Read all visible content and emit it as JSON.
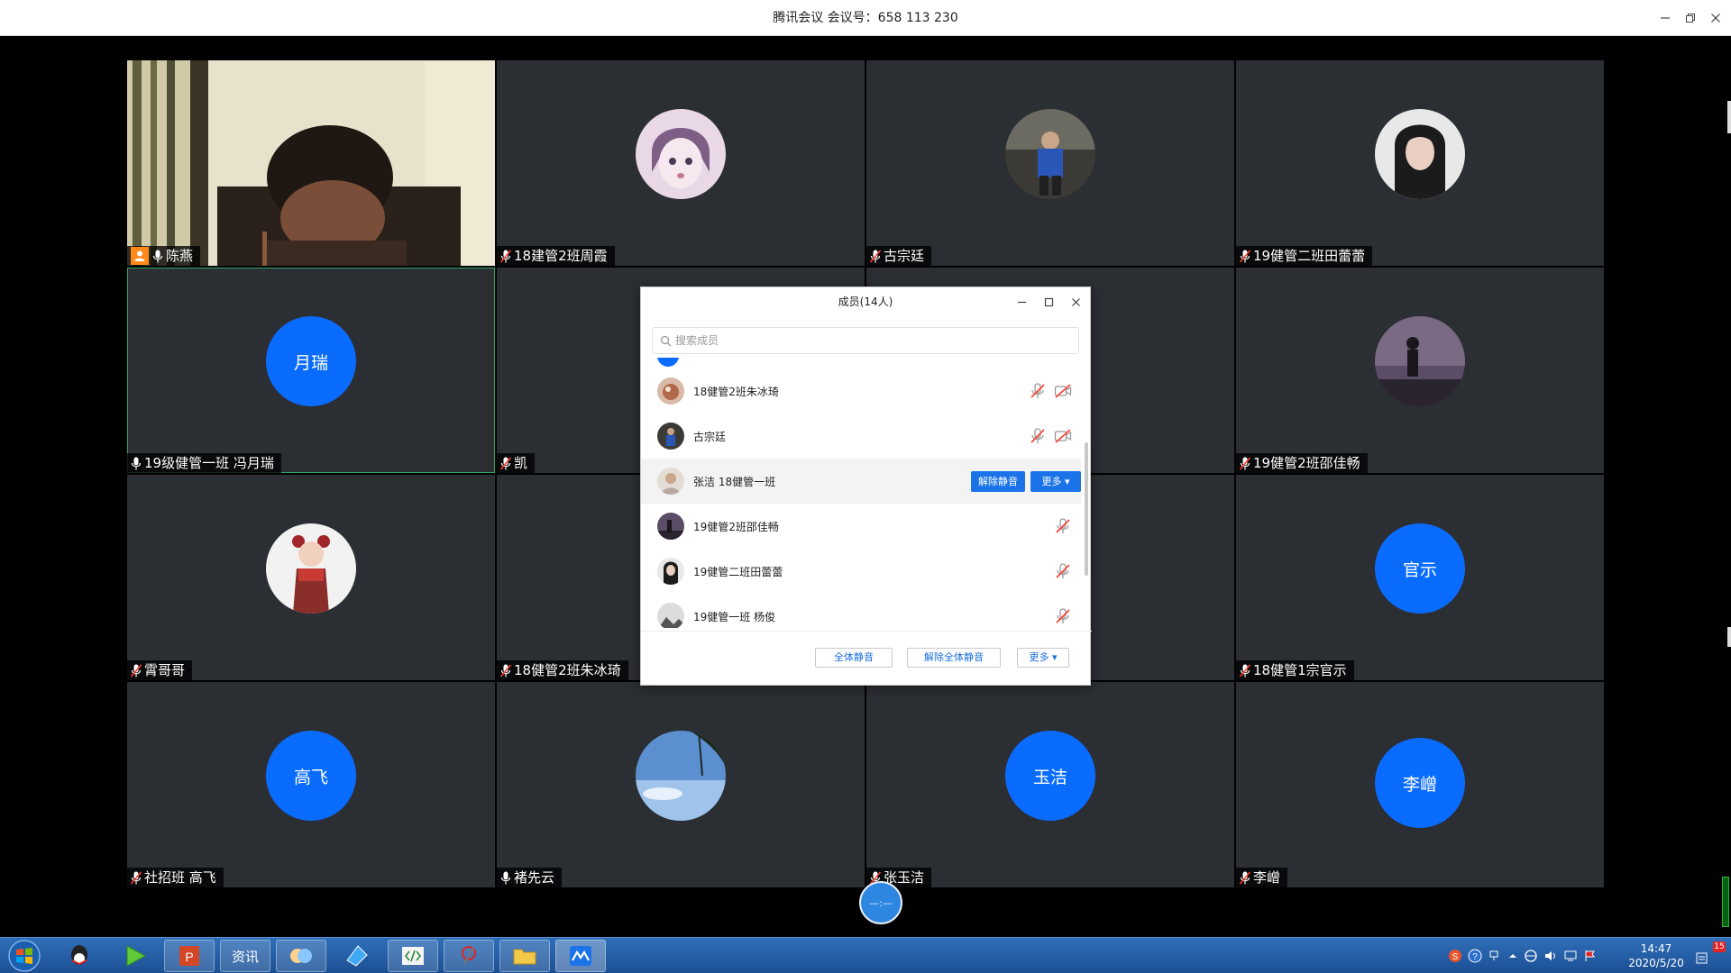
{
  "window": {
    "title": "腾讯会议 会议号：658 113 230"
  },
  "tiles": [
    {
      "name": "陈燕",
      "type": "camera",
      "host": true
    },
    {
      "name": "18建管2班周霞",
      "type": "photo",
      "muted": true
    },
    {
      "name": "古宗廷",
      "type": "photo",
      "muted": true
    },
    {
      "name": "19健管二班田蕾蕾",
      "type": "photo",
      "muted": true
    },
    {
      "name": "19级健管一班  冯月瑞",
      "type": "letter",
      "letter": "月瑞",
      "active": true
    },
    {
      "name": "凯",
      "type": "blank",
      "muted": true
    },
    {
      "name": "",
      "type": "blank"
    },
    {
      "name": "19健管2班邵佳畅",
      "type": "photo",
      "muted": true
    },
    {
      "name": "霄哥哥",
      "type": "photo",
      "muted": true
    },
    {
      "name": "18健管2班朱冰琦",
      "type": "blank",
      "muted": true
    },
    {
      "name": "",
      "type": "blank"
    },
    {
      "name": "18健管1宗官示",
      "type": "letter",
      "letter": "官示",
      "muted": true
    },
    {
      "name": "社招班  高飞",
      "type": "letter",
      "letter": "高飞",
      "muted": true
    },
    {
      "name": "褚先云",
      "type": "photo"
    },
    {
      "name": "张玉洁",
      "type": "letter",
      "letter": "玉洁",
      "muted": true
    },
    {
      "name": "李嶒",
      "type": "letter",
      "letter": "李嶒",
      "muted": true
    }
  ],
  "panel": {
    "title": "成员(14人)",
    "search_placeholder": "搜索成员",
    "members": [
      {
        "name": "18健管2班朱冰琦"
      },
      {
        "name": "古宗廷"
      },
      {
        "name": "张洁 18健管一班"
      },
      {
        "name": "19健管2班邵佳畅"
      },
      {
        "name": "19健管二班田蕾蕾"
      },
      {
        "name": "19健管一班   杨俊"
      }
    ],
    "unmute_btn": "解除静音",
    "more_btn": "更多 ▾",
    "footer": {
      "mute_all": "全体静音",
      "unmute_all": "解除全体静音",
      "more": "更多 ▾"
    }
  },
  "floatbtn": {
    "label": "—:—"
  },
  "taskbar": {
    "items": [
      "qq-icon",
      "player-icon",
      "powerpoint-icon",
      "news-icon",
      "chat-icon",
      "browser-icon",
      "code-icon",
      "tool-icon",
      "folder-icon",
      "meeting-icon"
    ],
    "news_label": "资讯",
    "time": "14:47",
    "date": "2020/5/20",
    "badge": "15"
  }
}
